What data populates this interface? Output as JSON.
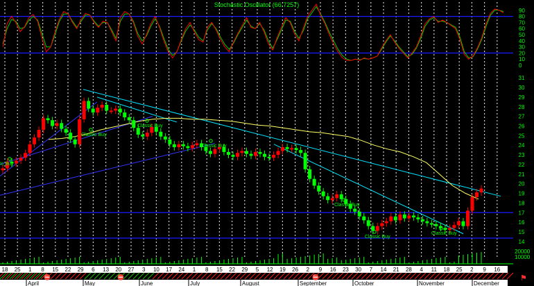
{
  "chart_data": {
    "type": "candlestick",
    "title": "Stochastic Oscillator (66.7257)",
    "colors": {
      "up": "#ff0000",
      "down": "#00ff00",
      "ma": "#ffff66",
      "trend": "#00e5ff",
      "channel": "#3333ff",
      "osc_k": "#ff0000",
      "osc_d": "#00cc00",
      "guide": "#1a1aff",
      "grid": "#cccccc"
    },
    "oscillator": {
      "yticks": [
        "90",
        "80",
        "70",
        "60",
        "50",
        "40",
        "30",
        "20",
        "10",
        "0"
      ],
      "ylim": [
        0,
        100
      ],
      "k": [
        30,
        68,
        80,
        70,
        55,
        63,
        78,
        83,
        72,
        45,
        22,
        30,
        55,
        75,
        88,
        84,
        70,
        60,
        75,
        85,
        82,
        70,
        62,
        72,
        70,
        55,
        40,
        78,
        88,
        84,
        70,
        48,
        35,
        50,
        68,
        80,
        62,
        40,
        22,
        12,
        22,
        42,
        60,
        70,
        55,
        42,
        38,
        62,
        70,
        58,
        42,
        30,
        22,
        38,
        52,
        65,
        78,
        62,
        60,
        70,
        55,
        35,
        25,
        45,
        62,
        78,
        70,
        52,
        40,
        60,
        80,
        90,
        100,
        82,
        68,
        50,
        35,
        22,
        12,
        8,
        8,
        10,
        8,
        12,
        10,
        12,
        15,
        28,
        40,
        50,
        38,
        28,
        20,
        12,
        20,
        30,
        48,
        68,
        76,
        80,
        70,
        74,
        70,
        65,
        60,
        42,
        18,
        10,
        15,
        28,
        45,
        68,
        85,
        92,
        90,
        86
      ],
      "d": [
        35,
        60,
        75,
        72,
        60,
        62,
        74,
        80,
        74,
        52,
        30,
        30,
        50,
        72,
        84,
        84,
        72,
        62,
        72,
        82,
        82,
        72,
        64,
        70,
        70,
        58,
        44,
        72,
        84,
        84,
        72,
        52,
        40,
        48,
        64,
        76,
        64,
        44,
        26,
        16,
        22,
        40,
        56,
        66,
        58,
        46,
        40,
        58,
        68,
        60,
        46,
        34,
        26,
        36,
        50,
        62,
        74,
        64,
        60,
        68,
        58,
        40,
        28,
        42,
        58,
        74,
        72,
        56,
        44,
        56,
        76,
        86,
        96,
        84,
        70,
        54,
        40,
        26,
        16,
        10,
        8,
        10,
        9,
        11,
        10,
        12,
        15,
        26,
        38,
        48,
        40,
        30,
        22,
        14,
        18,
        28,
        44,
        64,
        74,
        78,
        72,
        72,
        70,
        66,
        62,
        46,
        22,
        12,
        14,
        26,
        42,
        64,
        82,
        90,
        90,
        88
      ]
    },
    "price": {
      "yticks": [
        "31",
        "30",
        "29",
        "28",
        "27",
        "26",
        "25",
        "24",
        "23",
        "22",
        "21",
        "20",
        "19",
        "18",
        "17",
        "16",
        "15",
        "14"
      ],
      "ylim": [
        13.7,
        31.3
      ],
      "closes": [
        21.6,
        22.3,
        22.1,
        22.4,
        22.7,
        23.2,
        24.1,
        24.8,
        25.6,
        26.8,
        26.6,
        26.0,
        26.3,
        25.7,
        25.3,
        24.6,
        24.1,
        26.7,
        28.6,
        27.8,
        27.4,
        27.9,
        28.2,
        27.6,
        27.6,
        27.8,
        27.4,
        26.9,
        26.6,
        25.8,
        25.1,
        24.9,
        25.3,
        25.9,
        25.4,
        24.9,
        24.6,
        24.1,
        23.8,
        24.1,
        23.9,
        23.7,
        24.0,
        24.2,
        23.8,
        23.4,
        23.1,
        23.6,
        23.8,
        23.3,
        23.0,
        22.8,
        23.2,
        23.4,
        23.1,
        22.9,
        23.3,
        23.1,
        22.8,
        22.7,
        23.0,
        23.4,
        23.8,
        23.6,
        23.7,
        23.5,
        23.2,
        21.5,
        20.5,
        19.8,
        19.2,
        18.7,
        18.3,
        18.5,
        18.9,
        18.4,
        17.9,
        17.4,
        17.1,
        16.6,
        16.2,
        15.6,
        15.1,
        15.6,
        15.9,
        16.1,
        16.6,
        16.2,
        16.8,
        16.4,
        16.7,
        16.5,
        16.3,
        16.1,
        15.9,
        15.8,
        15.6,
        15.4,
        15.2,
        15.4,
        15.7,
        16.1,
        15.6,
        17.2,
        18.6,
        19.1,
        19.5
      ],
      "ma": [
        24.6,
        24.7,
        24.9,
        25.2,
        25.6,
        25.9,
        26.2,
        26.5,
        26.7,
        26.8,
        26.8,
        26.7,
        26.7,
        26.6,
        26.5,
        26.3,
        26.1,
        26.0,
        25.8,
        25.6,
        25.4,
        25.3,
        25.1,
        24.9,
        24.5,
        24.0,
        23.6,
        23.3,
        22.8,
        22.2,
        21.0,
        19.8,
        19.0,
        18.4
      ],
      "buy_labels": [
        "Ic Buy",
        "Classic Buy",
        "Classic Buy",
        "Classic Buy",
        "Classic Buy",
        "Classic Buy",
        "Classic Buy"
      ]
    },
    "volume": {
      "yticks": [
        "20000",
        "10000"
      ]
    },
    "days": [
      "18",
      "25",
      "1",
      "8",
      "15",
      "22",
      "29",
      "6",
      "13",
      "20",
      "27",
      "3",
      "10",
      "17",
      "24",
      "1",
      "8",
      "15",
      "22",
      "29",
      "5",
      "12",
      "19",
      "26",
      "2",
      "9",
      "16",
      "23",
      "30",
      "7",
      "14",
      "21",
      "28",
      "4",
      "11",
      "18",
      "25",
      "2",
      "9",
      "16"
    ],
    "months": [
      "April",
      "May",
      "June",
      "July",
      "August",
      "September",
      "October",
      "November",
      "December"
    ]
  }
}
